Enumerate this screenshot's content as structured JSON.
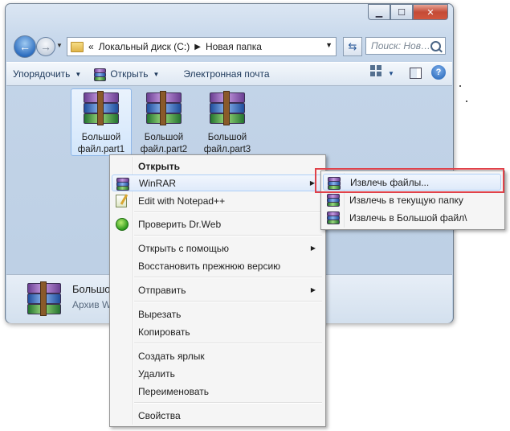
{
  "window": {
    "address": {
      "drive": "Локальный диск (C:)",
      "folder": "Новая папка",
      "prefix": "«"
    },
    "search_placeholder": "Поиск: Нов…",
    "toolbar": {
      "organize": "Упорядочить",
      "open": "Открыть",
      "email": "Электронная почта",
      "help": "?"
    },
    "files": [
      {
        "line1": "Большой",
        "line2": "файл.part1",
        "selected": true
      },
      {
        "line1": "Большой",
        "line2": "файл.part2",
        "selected": false
      },
      {
        "line1": "Большой",
        "line2": "файл.part3",
        "selected": false
      }
    ],
    "details": {
      "name": "Большой файл.part1",
      "type": "Архив WinRAR"
    }
  },
  "context_menu": {
    "items": [
      {
        "label": "Открыть",
        "bold": true
      },
      {
        "label": "WinRAR",
        "icon": "winrar-icon",
        "submenu": true,
        "hover": true
      },
      {
        "label": "Edit with Notepad++",
        "icon": "notepad-plus-plus-icon"
      },
      {
        "label": "Проверить Dr.Web",
        "icon": "drweb-icon"
      },
      {
        "label": "Открыть с помощью",
        "submenu": true
      },
      {
        "label": "Восстановить прежнюю версию"
      },
      {
        "label": "Отправить",
        "submenu": true
      },
      {
        "label": "Вырезать"
      },
      {
        "label": "Копировать"
      },
      {
        "label": "Создать ярлык"
      },
      {
        "label": "Удалить"
      },
      {
        "label": "Переименовать"
      },
      {
        "label": "Свойства"
      }
    ]
  },
  "winrar_submenu": {
    "items": [
      {
        "label": "Извлечь файлы...",
        "hover": true
      },
      {
        "label": "Извлечь в текущую папку"
      },
      {
        "label": "Извлечь в Большой файл\\"
      }
    ]
  },
  "colors": {
    "highlight_box": "#e0424a",
    "menu_hover": "#dfeafa"
  }
}
